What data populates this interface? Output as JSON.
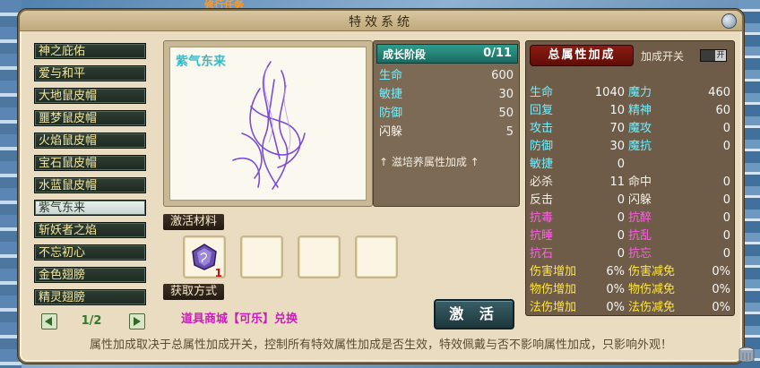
{
  "quest_hint": "修行任务",
  "window": {
    "title": "特效系统"
  },
  "effect_list": {
    "items": [
      {
        "label": "神之庇佑"
      },
      {
        "label": "爱与和平"
      },
      {
        "label": "大地鼠皮帽"
      },
      {
        "label": "噩梦鼠皮帽"
      },
      {
        "label": "火焰鼠皮帽"
      },
      {
        "label": "宝石鼠皮帽"
      },
      {
        "label": "水蓝鼠皮帽"
      },
      {
        "label": "紫气东来",
        "selected": true
      },
      {
        "label": "斩妖者之焰"
      },
      {
        "label": "不忘初心"
      },
      {
        "label": "金色翅膀"
      },
      {
        "label": "精灵翅膀"
      }
    ],
    "page": "1/2"
  },
  "preview": {
    "name": "紫气东来",
    "effect_color": "#7a4cd8"
  },
  "growth": {
    "stage_label": "成长阶段",
    "stage_value": "0/11",
    "stats": [
      {
        "label": "生命",
        "value": "600",
        "color": "cyan"
      },
      {
        "label": "敏捷",
        "value": "30",
        "color": "cyan"
      },
      {
        "label": "防御",
        "value": "50",
        "color": "cyan"
      },
      {
        "label": "闪躲",
        "value": "5",
        "color": "white"
      }
    ],
    "hint": "↑ 滋培养属性加成 ↑"
  },
  "total": {
    "header": "总属性加成",
    "toggle_label": "加成开关",
    "toggle_state": "开",
    "rows": [
      {
        "k1": "生命",
        "v1": "1040",
        "c1": "cyan",
        "k2": "魔力",
        "v2": "460",
        "c2": "cyan"
      },
      {
        "k1": "回复",
        "v1": "10",
        "c1": "cyan",
        "k2": "精神",
        "v2": "60",
        "c2": "cyan"
      },
      {
        "k1": "攻击",
        "v1": "70",
        "c1": "cyan",
        "k2": "魔攻",
        "v2": "0",
        "c2": "cyan"
      },
      {
        "k1": "防御",
        "v1": "30",
        "c1": "cyan",
        "k2": "魔抗",
        "v2": "0",
        "c2": "cyan"
      },
      {
        "k1": "敏捷",
        "v1": "0",
        "c1": "cyan",
        "k2": "",
        "v2": "",
        "c2": "cyan"
      },
      {
        "k1": "必杀",
        "v1": "11",
        "c1": "white",
        "k2": "命中",
        "v2": "0",
        "c2": "white"
      },
      {
        "k1": "反击",
        "v1": "0",
        "c1": "white",
        "k2": "闪躲",
        "v2": "0",
        "c2": "white"
      },
      {
        "k1": "抗毒",
        "v1": "0",
        "c1": "magenta",
        "k2": "抗醉",
        "v2": "0",
        "c2": "magenta"
      },
      {
        "k1": "抗睡",
        "v1": "0",
        "c1": "magenta",
        "k2": "抗乱",
        "v2": "0",
        "c2": "magenta"
      },
      {
        "k1": "抗石",
        "v1": "0",
        "c1": "magenta",
        "k2": "抗忘",
        "v2": "0",
        "c2": "magenta"
      },
      {
        "k1": "伤害增加",
        "v1": "6%",
        "c1": "yellow",
        "k2": "伤害减免",
        "v2": "0%",
        "c2": "yellow"
      },
      {
        "k1": "物伤增加",
        "v1": "0%",
        "c1": "yellow",
        "k2": "物伤减免",
        "v2": "0%",
        "c2": "yellow"
      },
      {
        "k1": "法伤增加",
        "v1": "0%",
        "c1": "yellow",
        "k2": "法伤减免",
        "v2": "0%",
        "c2": "yellow"
      }
    ]
  },
  "materials": {
    "label": "激活材料",
    "slots": [
      {
        "icon": "purple-gem-icon",
        "count": "1"
      },
      {
        "icon": "",
        "count": ""
      },
      {
        "icon": "",
        "count": ""
      },
      {
        "icon": "",
        "count": ""
      }
    ]
  },
  "obtain": {
    "label": "获取方式",
    "text": "道具商城【可乐】兑换"
  },
  "activate_button": "激 活",
  "footer": "属性加成取决于总属性加成开关，控制所有特效属性加成是否生效，特效佩戴与否不影响属性加成，只影响外观！"
}
